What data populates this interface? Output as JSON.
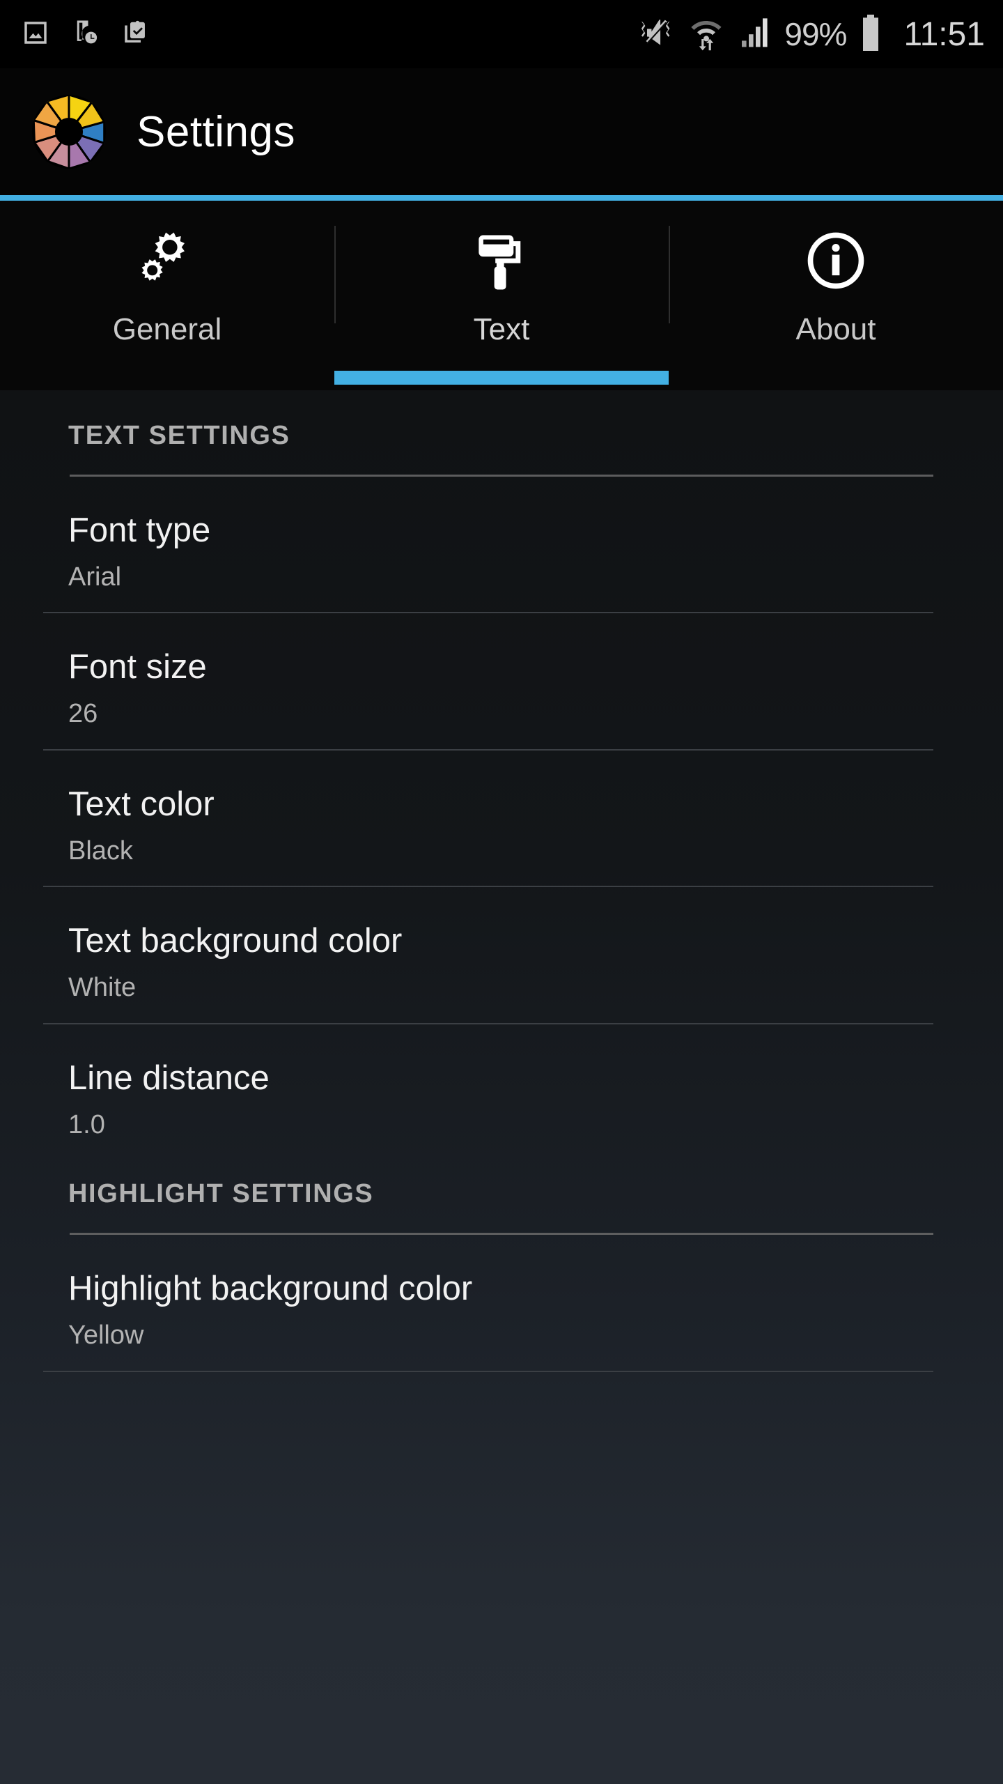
{
  "statusbar": {
    "left_icons": [
      "image-icon",
      "device-clock-icon",
      "clipboard-check-icon"
    ],
    "right_icons": [
      "vibrate-mute-icon",
      "wifi-transfer-icon",
      "signal-bars-icon",
      "battery-icon"
    ],
    "battery_percent": "99%",
    "time": "11:51"
  },
  "appbar": {
    "logo_icon": "aperture-logo-icon",
    "title": "Settings",
    "accent_color": "#43B0E3"
  },
  "tabs": [
    {
      "label": "General",
      "icon": "gears-icon",
      "active": false
    },
    {
      "label": "Text",
      "icon": "paint-roller-icon",
      "active": true
    },
    {
      "label": "About",
      "icon": "info-circle-icon",
      "active": false
    }
  ],
  "sections": [
    {
      "header": "TEXT SETTINGS",
      "rows": [
        {
          "title": "Font type",
          "value": "Arial"
        },
        {
          "title": "Font size",
          "value": "26"
        },
        {
          "title": "Text color",
          "value": "Black"
        },
        {
          "title": "Text background color",
          "value": "White"
        },
        {
          "title": "Line distance",
          "value": "1.0"
        }
      ]
    },
    {
      "header": "HIGHLIGHT SETTINGS",
      "rows": [
        {
          "title": "Highlight background color",
          "value": "Yellow"
        }
      ]
    }
  ]
}
